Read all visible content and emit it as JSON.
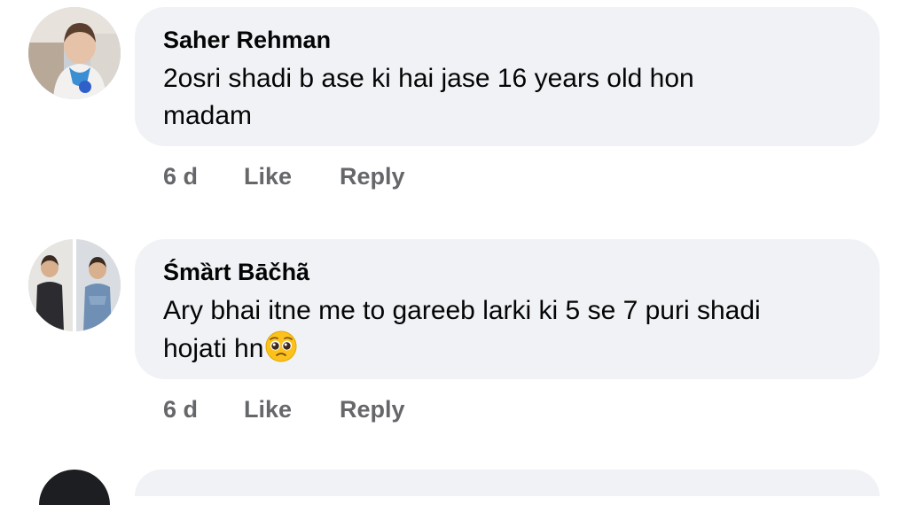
{
  "comments": [
    {
      "author": "Saher Rehman",
      "text_line1": "2osri shadi b ase ki hai jase 16 years old hon",
      "text_line2": "madam",
      "time": "6 d",
      "like_label": "Like",
      "reply_label": "Reply",
      "avatar_icon": "profile-photo-child-icon"
    },
    {
      "author": "Śmȁrt Bāčhã",
      "text_line1": "Ary bhai itne me to gareeb larki ki 5 se 7 puri shadi",
      "text_line2": "hojati hn",
      "emoji": "pleading-face-emoji-icon",
      "time": "6 d",
      "like_label": "Like",
      "reply_label": "Reply",
      "avatar_icon": "profile-photo-two-children-icon"
    }
  ],
  "colors": {
    "bubble_bg": "#f0f2f5",
    "text_primary": "#050505",
    "text_secondary": "#65676b"
  }
}
